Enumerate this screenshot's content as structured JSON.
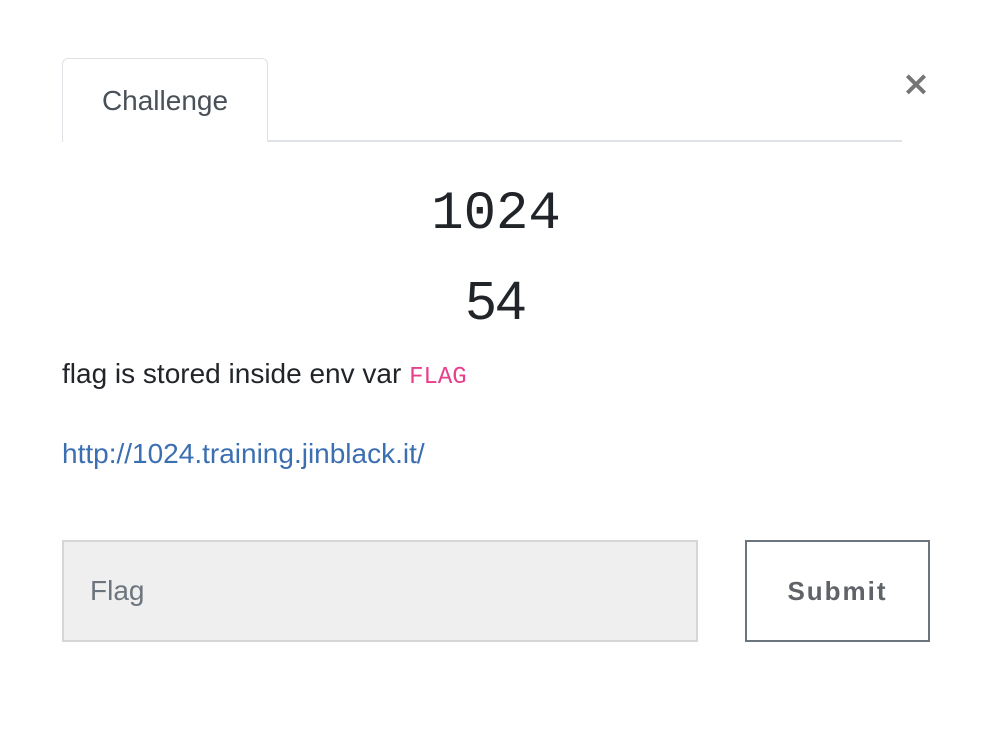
{
  "modal": {
    "close_glyph": "×",
    "tabs": [
      {
        "label": "Challenge",
        "active": true
      }
    ],
    "challenge": {
      "name": "1024",
      "value": "54",
      "description_text": "flag is stored inside env var ",
      "description_code": "FLAG",
      "link": "http://1024.training.jinblack.it/"
    },
    "form": {
      "flag_placeholder": "Flag",
      "flag_value": "",
      "submit_label": "Submit"
    }
  },
  "colors": {
    "link": "#3b6fb2",
    "code": "#e83e8c",
    "text": "#212529",
    "input_bg": "#efefef"
  },
  "icons": {
    "close": "close-icon"
  }
}
